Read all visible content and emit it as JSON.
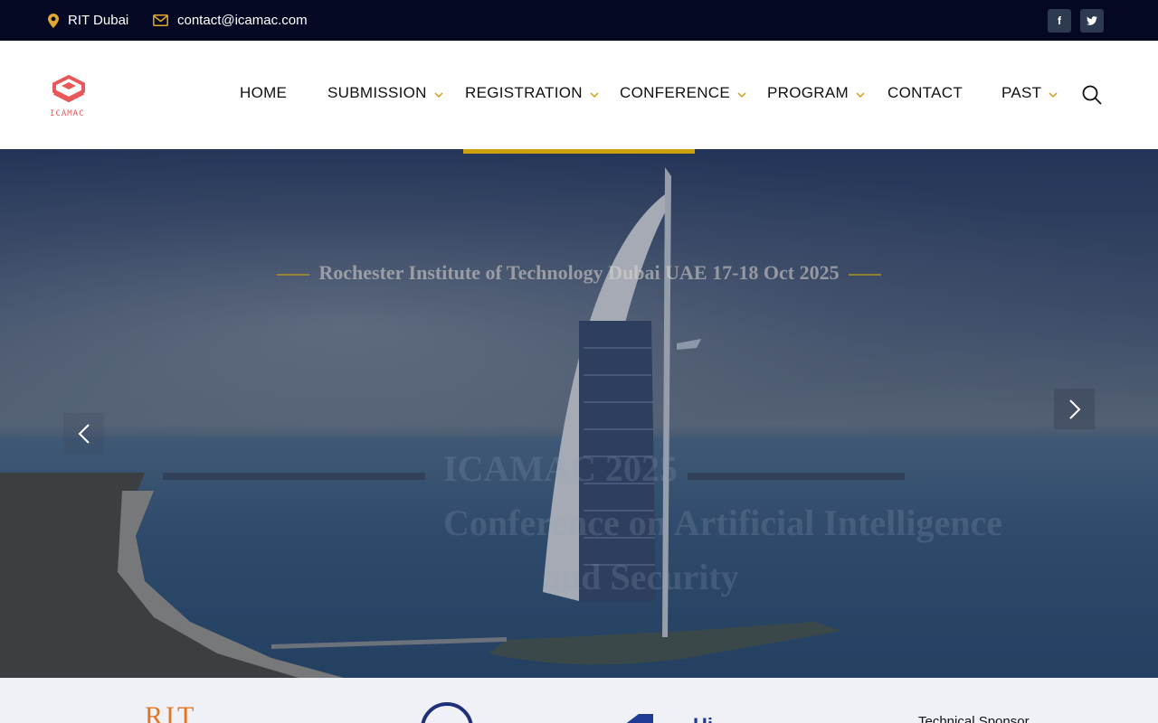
{
  "topbar": {
    "location": "RIT Dubai",
    "email": "contact@icamac.com",
    "social": {
      "facebook": "f",
      "twitter": "t"
    }
  },
  "header": {
    "logo_text": "ICAMAC",
    "nav": [
      {
        "label": "HOME",
        "has_dropdown": false
      },
      {
        "label": "SUBMISSION",
        "has_dropdown": true
      },
      {
        "label": "REGISTRATION",
        "has_dropdown": true
      },
      {
        "label": "CONFERENCE",
        "has_dropdown": true
      },
      {
        "label": "PROGRAM",
        "has_dropdown": true
      },
      {
        "label": "CONTACT",
        "has_dropdown": false
      },
      {
        "label": "PAST",
        "has_dropdown": true
      }
    ],
    "active_item": "REGISTRATION"
  },
  "hero": {
    "subtitle": "Rochester Institute of Technology Dubai UAE 17-18 Oct 2025",
    "ghost_line1": "ICAMAC 2025",
    "ghost_line2": "Conference on Artificial Intelligence",
    "ghost_line3": "and Security",
    "accent_color": "#cda00d"
  },
  "sponsors": {
    "rit": "RIT",
    "blue_text": "Hi",
    "tech_label": "Technical Sponsor"
  },
  "colors": {
    "topbar_bg": "#050822",
    "accent": "#cda00d",
    "logo": "#e8585a"
  }
}
